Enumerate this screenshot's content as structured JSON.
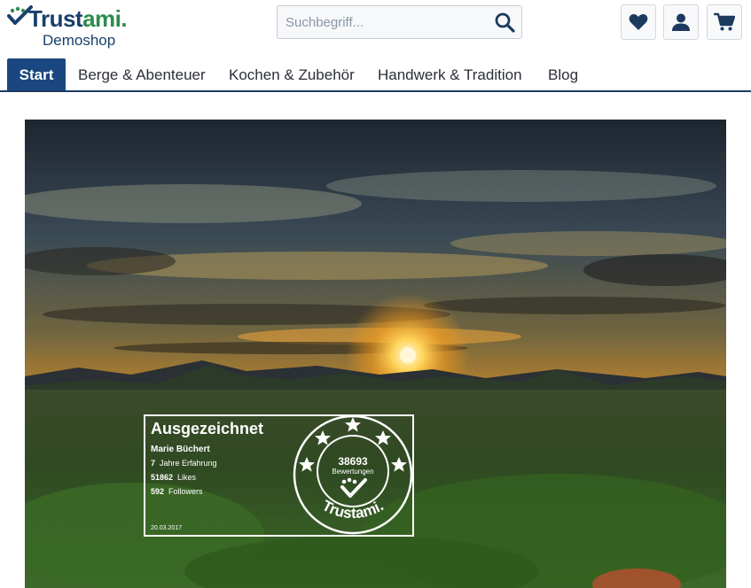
{
  "logo": {
    "word_main": "Trust",
    "word_accent": "ami.",
    "subtitle": "Demoshop",
    "colors": {
      "navy": "#18406b",
      "green": "#2e8c4f"
    }
  },
  "search": {
    "placeholder": "Suchbegriff...",
    "value": "",
    "icon": "search-icon"
  },
  "header_buttons": [
    {
      "name": "wishlist",
      "icon": "heart-icon"
    },
    {
      "name": "account",
      "icon": "user-icon"
    },
    {
      "name": "cart",
      "icon": "cart-icon"
    }
  ],
  "nav": {
    "items": [
      {
        "label": "Start",
        "active": true
      },
      {
        "label": "Berge & Abenteuer",
        "active": false
      },
      {
        "label": "Kochen & Zubehör",
        "active": false
      },
      {
        "label": "Handwerk & Tradition",
        "active": false
      },
      {
        "label": "Blog",
        "active": false
      }
    ],
    "active_color": "#1a4780"
  },
  "hero": {
    "image": "sunset-landscape",
    "badge": {
      "title": "Ausgezeichnet",
      "name": "Marie Büchert",
      "stats": [
        {
          "value": "7",
          "label": "Jahre Erfahrung"
        },
        {
          "value": "51862",
          "label": "Likes"
        },
        {
          "value": "592",
          "label": "Followers"
        }
      ],
      "date": "20.03.2017",
      "seal": {
        "count": "38693",
        "label": "Bewertungen",
        "brand": "Trustami.",
        "stars": 5
      }
    }
  }
}
